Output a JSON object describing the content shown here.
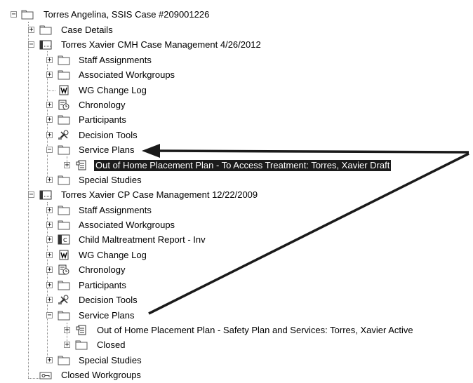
{
  "tree": {
    "root": {
      "label": "Torres Angelina, SSIS Case #209001226",
      "icon": "folder-icon"
    },
    "case_details": {
      "label": "Case Details",
      "icon": "folder-icon"
    },
    "cmh": {
      "label": "Torres Xavier CMH Case Management 4/26/2012",
      "icon": "case-management-icon",
      "children": {
        "staff_assignments": {
          "label": "Staff Assignments",
          "icon": "folder-icon"
        },
        "associated_workgroups": {
          "label": "Associated Workgroups",
          "icon": "folder-icon"
        },
        "wg_change_log": {
          "label": "WG Change Log",
          "icon": "log-document-icon"
        },
        "chronology": {
          "label": "Chronology",
          "icon": "chronology-icon"
        },
        "participants": {
          "label": "Participants",
          "icon": "folder-icon"
        },
        "decision_tools": {
          "label": "Decision Tools",
          "icon": "decision-tools-icon"
        },
        "service_plans": {
          "label": "Service Plans",
          "icon": "folder-icon"
        },
        "oohp_access": {
          "label": "Out of Home Placement Plan - To Access Treatment:  Torres, Xavier Draft",
          "icon": "plan-document-icon",
          "selected": true
        },
        "special_studies": {
          "label": "Special Studies",
          "icon": "folder-icon"
        }
      }
    },
    "cp": {
      "label": "Torres Xavier CP Case Management 12/22/2009",
      "icon": "case-management-icon",
      "children": {
        "staff_assignments": {
          "label": "Staff Assignments",
          "icon": "folder-icon"
        },
        "associated_workgroups": {
          "label": "Associated Workgroups",
          "icon": "folder-icon"
        },
        "child_maltreatment": {
          "label": "Child Maltreatment Report - Inv",
          "icon": "report-icon"
        },
        "wg_change_log": {
          "label": "WG Change Log",
          "icon": "log-document-icon"
        },
        "chronology": {
          "label": "Chronology",
          "icon": "chronology-icon"
        },
        "participants": {
          "label": "Participants",
          "icon": "folder-icon"
        },
        "decision_tools": {
          "label": "Decision Tools",
          "icon": "decision-tools-icon"
        },
        "service_plans": {
          "label": "Service Plans",
          "icon": "folder-icon"
        },
        "oohp_safety": {
          "label": "Out of Home Placement Plan - Safety Plan and Services:  Torres, Xavier Active",
          "icon": "plan-document-icon"
        },
        "closed": {
          "label": "Closed",
          "icon": "folder-icon"
        },
        "special_studies": {
          "label": "Special Studies",
          "icon": "folder-icon"
        }
      }
    },
    "closed_workgroups": {
      "label": "Closed Workgroups",
      "icon": "key-icon"
    }
  },
  "colors": {
    "selection_bg": "#1b1b1b",
    "selection_text": "#ffffff",
    "arrow": "#1a1a1a",
    "guide": "#8a8a8a"
  }
}
